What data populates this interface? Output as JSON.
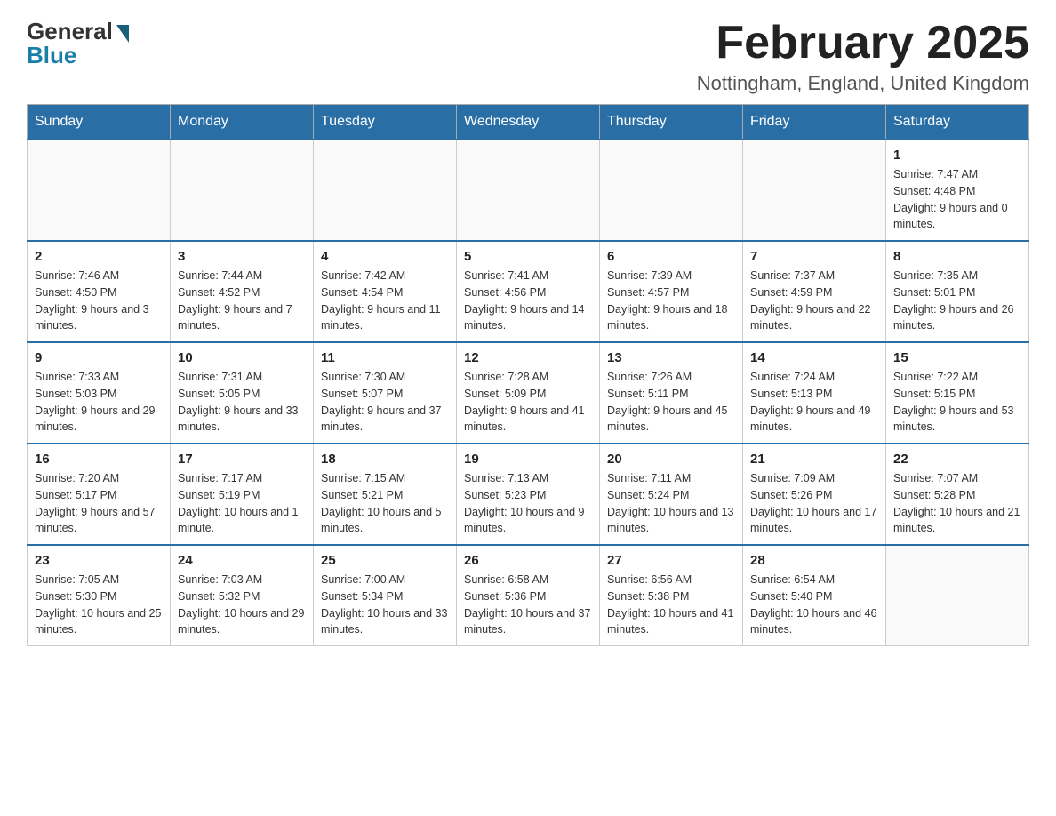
{
  "header": {
    "logo_general": "General",
    "logo_blue": "Blue",
    "month_title": "February 2025",
    "location": "Nottingham, England, United Kingdom"
  },
  "days_of_week": [
    "Sunday",
    "Monday",
    "Tuesday",
    "Wednesday",
    "Thursday",
    "Friday",
    "Saturday"
  ],
  "weeks": [
    [
      {
        "day": "",
        "info": ""
      },
      {
        "day": "",
        "info": ""
      },
      {
        "day": "",
        "info": ""
      },
      {
        "day": "",
        "info": ""
      },
      {
        "day": "",
        "info": ""
      },
      {
        "day": "",
        "info": ""
      },
      {
        "day": "1",
        "info": "Sunrise: 7:47 AM\nSunset: 4:48 PM\nDaylight: 9 hours and 0 minutes."
      }
    ],
    [
      {
        "day": "2",
        "info": "Sunrise: 7:46 AM\nSunset: 4:50 PM\nDaylight: 9 hours and 3 minutes."
      },
      {
        "day": "3",
        "info": "Sunrise: 7:44 AM\nSunset: 4:52 PM\nDaylight: 9 hours and 7 minutes."
      },
      {
        "day": "4",
        "info": "Sunrise: 7:42 AM\nSunset: 4:54 PM\nDaylight: 9 hours and 11 minutes."
      },
      {
        "day": "5",
        "info": "Sunrise: 7:41 AM\nSunset: 4:56 PM\nDaylight: 9 hours and 14 minutes."
      },
      {
        "day": "6",
        "info": "Sunrise: 7:39 AM\nSunset: 4:57 PM\nDaylight: 9 hours and 18 minutes."
      },
      {
        "day": "7",
        "info": "Sunrise: 7:37 AM\nSunset: 4:59 PM\nDaylight: 9 hours and 22 minutes."
      },
      {
        "day": "8",
        "info": "Sunrise: 7:35 AM\nSunset: 5:01 PM\nDaylight: 9 hours and 26 minutes."
      }
    ],
    [
      {
        "day": "9",
        "info": "Sunrise: 7:33 AM\nSunset: 5:03 PM\nDaylight: 9 hours and 29 minutes."
      },
      {
        "day": "10",
        "info": "Sunrise: 7:31 AM\nSunset: 5:05 PM\nDaylight: 9 hours and 33 minutes."
      },
      {
        "day": "11",
        "info": "Sunrise: 7:30 AM\nSunset: 5:07 PM\nDaylight: 9 hours and 37 minutes."
      },
      {
        "day": "12",
        "info": "Sunrise: 7:28 AM\nSunset: 5:09 PM\nDaylight: 9 hours and 41 minutes."
      },
      {
        "day": "13",
        "info": "Sunrise: 7:26 AM\nSunset: 5:11 PM\nDaylight: 9 hours and 45 minutes."
      },
      {
        "day": "14",
        "info": "Sunrise: 7:24 AM\nSunset: 5:13 PM\nDaylight: 9 hours and 49 minutes."
      },
      {
        "day": "15",
        "info": "Sunrise: 7:22 AM\nSunset: 5:15 PM\nDaylight: 9 hours and 53 minutes."
      }
    ],
    [
      {
        "day": "16",
        "info": "Sunrise: 7:20 AM\nSunset: 5:17 PM\nDaylight: 9 hours and 57 minutes."
      },
      {
        "day": "17",
        "info": "Sunrise: 7:17 AM\nSunset: 5:19 PM\nDaylight: 10 hours and 1 minute."
      },
      {
        "day": "18",
        "info": "Sunrise: 7:15 AM\nSunset: 5:21 PM\nDaylight: 10 hours and 5 minutes."
      },
      {
        "day": "19",
        "info": "Sunrise: 7:13 AM\nSunset: 5:23 PM\nDaylight: 10 hours and 9 minutes."
      },
      {
        "day": "20",
        "info": "Sunrise: 7:11 AM\nSunset: 5:24 PM\nDaylight: 10 hours and 13 minutes."
      },
      {
        "day": "21",
        "info": "Sunrise: 7:09 AM\nSunset: 5:26 PM\nDaylight: 10 hours and 17 minutes."
      },
      {
        "day": "22",
        "info": "Sunrise: 7:07 AM\nSunset: 5:28 PM\nDaylight: 10 hours and 21 minutes."
      }
    ],
    [
      {
        "day": "23",
        "info": "Sunrise: 7:05 AM\nSunset: 5:30 PM\nDaylight: 10 hours and 25 minutes."
      },
      {
        "day": "24",
        "info": "Sunrise: 7:03 AM\nSunset: 5:32 PM\nDaylight: 10 hours and 29 minutes."
      },
      {
        "day": "25",
        "info": "Sunrise: 7:00 AM\nSunset: 5:34 PM\nDaylight: 10 hours and 33 minutes."
      },
      {
        "day": "26",
        "info": "Sunrise: 6:58 AM\nSunset: 5:36 PM\nDaylight: 10 hours and 37 minutes."
      },
      {
        "day": "27",
        "info": "Sunrise: 6:56 AM\nSunset: 5:38 PM\nDaylight: 10 hours and 41 minutes."
      },
      {
        "day": "28",
        "info": "Sunrise: 6:54 AM\nSunset: 5:40 PM\nDaylight: 10 hours and 46 minutes."
      },
      {
        "day": "",
        "info": ""
      }
    ]
  ]
}
